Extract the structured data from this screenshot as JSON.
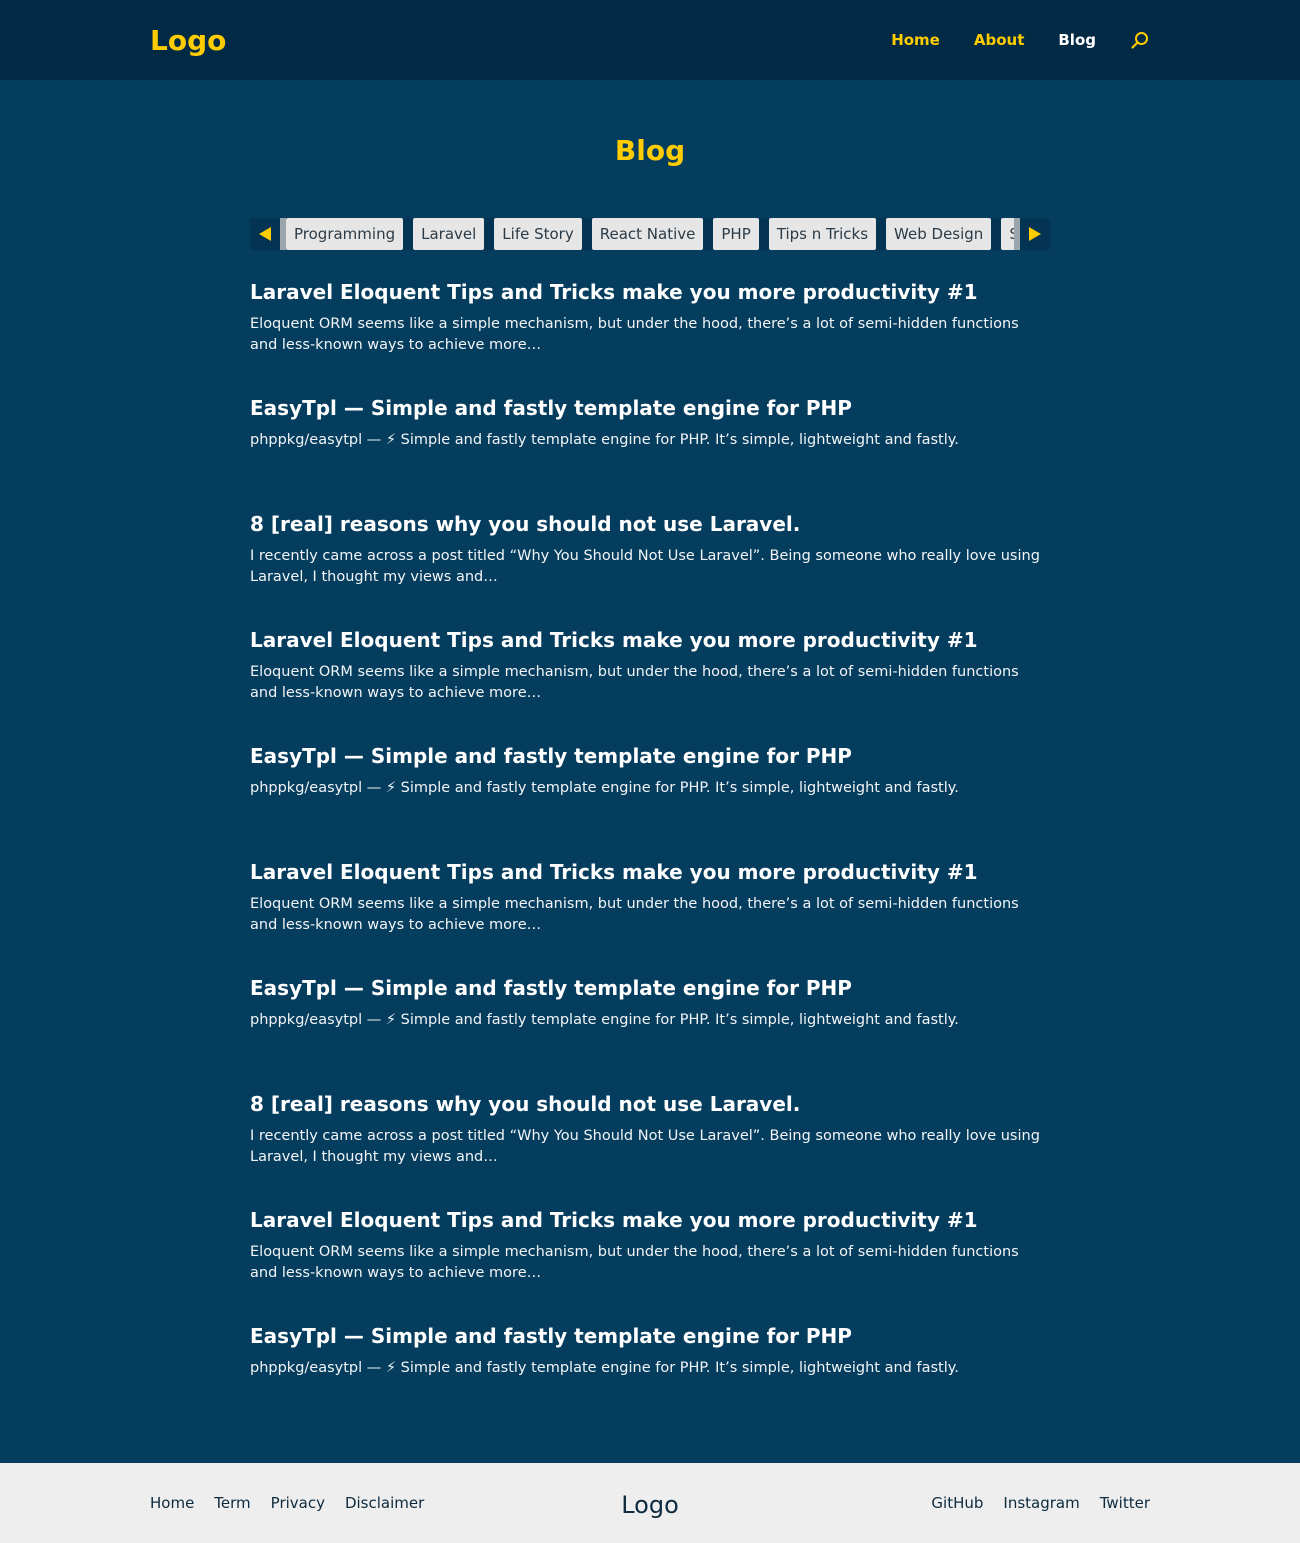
{
  "header": {
    "logo": "Logo",
    "nav": [
      {
        "label": "Home"
      },
      {
        "label": "About"
      },
      {
        "label": "Blog"
      }
    ],
    "search_icon": "search-icon"
  },
  "page": {
    "title": "Blog"
  },
  "tags": [
    "Programming",
    "Laravel",
    "Life Story",
    "React Native",
    "PHP",
    "Tips n Tricks",
    "Web Design",
    "SASS"
  ],
  "posts": [
    {
      "title": "Laravel Eloquent Tips and Tricks make you more productivity #1",
      "excerpt": "Eloquent ORM seems like a simple mechanism, but under the hood, there’s a lot of semi-hidden functions and less-known ways to achieve more…"
    },
    {
      "title": "EasyTpl — Simple and fastly template engine for PHP",
      "excerpt": "phppkg/easytpl — ⚡ Simple and fastly template engine for PHP. It’s simple, lightweight and fastly."
    },
    {
      "title": "8 [real] reasons why you should not use Laravel.",
      "excerpt": "I recently came across a post titled “Why You Should Not Use Laravel”. Being someone who really love using Laravel, I thought my views and…"
    },
    {
      "title": "Laravel Eloquent Tips and Tricks make you more productivity #1",
      "excerpt": "Eloquent ORM seems like a simple mechanism, but under the hood, there’s a lot of semi-hidden functions and less-known ways to achieve more…"
    },
    {
      "title": "EasyTpl — Simple and fastly template engine for PHP",
      "excerpt": "phppkg/easytpl — ⚡ Simple and fastly template engine for PHP. It’s simple, lightweight and fastly."
    },
    {
      "title": "Laravel Eloquent Tips and Tricks make you more productivity #1",
      "excerpt": "Eloquent ORM seems like a simple mechanism, but under the hood, there’s a lot of semi-hidden functions and less-known ways to achieve more…"
    },
    {
      "title": "EasyTpl — Simple and fastly template engine for PHP",
      "excerpt": "phppkg/easytpl — ⚡ Simple and fastly template engine for PHP. It’s simple, lightweight and fastly."
    },
    {
      "title": "8 [real] reasons why you should not use Laravel.",
      "excerpt": "I recently came across a post titled “Why You Should Not Use Laravel”. Being someone who really love using Laravel, I thought my views and…"
    },
    {
      "title": "Laravel Eloquent Tips and Tricks make you more productivity #1",
      "excerpt": "Eloquent ORM seems like a simple mechanism, but under the hood, there’s a lot of semi-hidden functions and less-known ways to achieve more…"
    },
    {
      "title": "EasyTpl — Simple and fastly template engine for PHP",
      "excerpt": "phppkg/easytpl — ⚡ Simple and fastly template engine for PHP. It’s simple, lightweight and fastly."
    }
  ],
  "footer": {
    "left_links": [
      "Home",
      "Term",
      "Privacy",
      "Disclaimer"
    ],
    "logo": "Logo",
    "right_links": [
      "GitHub",
      "Instagram",
      "Twitter"
    ]
  },
  "colors": {
    "accent": "#ffcc00",
    "background": "#053d5e",
    "header_bg": "#022a45",
    "footer_bg": "#eeeeee"
  }
}
